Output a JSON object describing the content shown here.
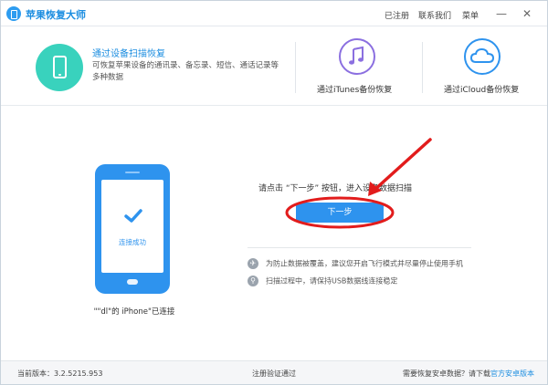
{
  "app": {
    "title": "苹果恢复大师"
  },
  "top_links": {
    "registered": "已注册",
    "contact": "联系我们",
    "menu": "菜单"
  },
  "window_controls": {
    "minimize": "—",
    "close": "✕"
  },
  "modes": {
    "device": {
      "title": "通过设备扫描恢复",
      "description": "可恢复苹果设备的通讯录、备忘录、短信、通话记录等多种数据",
      "icon": "phone-icon"
    },
    "itunes": {
      "label": "通过iTunes备份恢复",
      "icon": "music-note-icon",
      "color": "#8b6fe0"
    },
    "icloud": {
      "label": "通过iCloud备份恢复",
      "icon": "cloud-icon",
      "color": "#2e93ee"
    }
  },
  "main": {
    "phone_status": "连接成功",
    "device_caption": "\"\"dl\"的 iPhone\"已连接",
    "prompt": "请点击 “下一步” 按钮，进入设备数据扫描",
    "next_button": "下一步",
    "tips": [
      {
        "icon": "airplane-icon",
        "text": "为防止数据被覆盖，建议您开启飞行模式并尽量停止使用手机"
      },
      {
        "icon": "usb-icon",
        "text": "扫描过程中，请保持USB数据线连接稳定"
      }
    ]
  },
  "footer": {
    "version": "当前版本：3.2.5215.953",
    "register": "注册验证通过",
    "android_prefix": "需要恢复安卓数据？请下载",
    "android_link": "官方安卓版本"
  },
  "colors": {
    "accent": "#2e93ee",
    "teal": "#39d2bd",
    "annotation": "#e21c1c"
  }
}
